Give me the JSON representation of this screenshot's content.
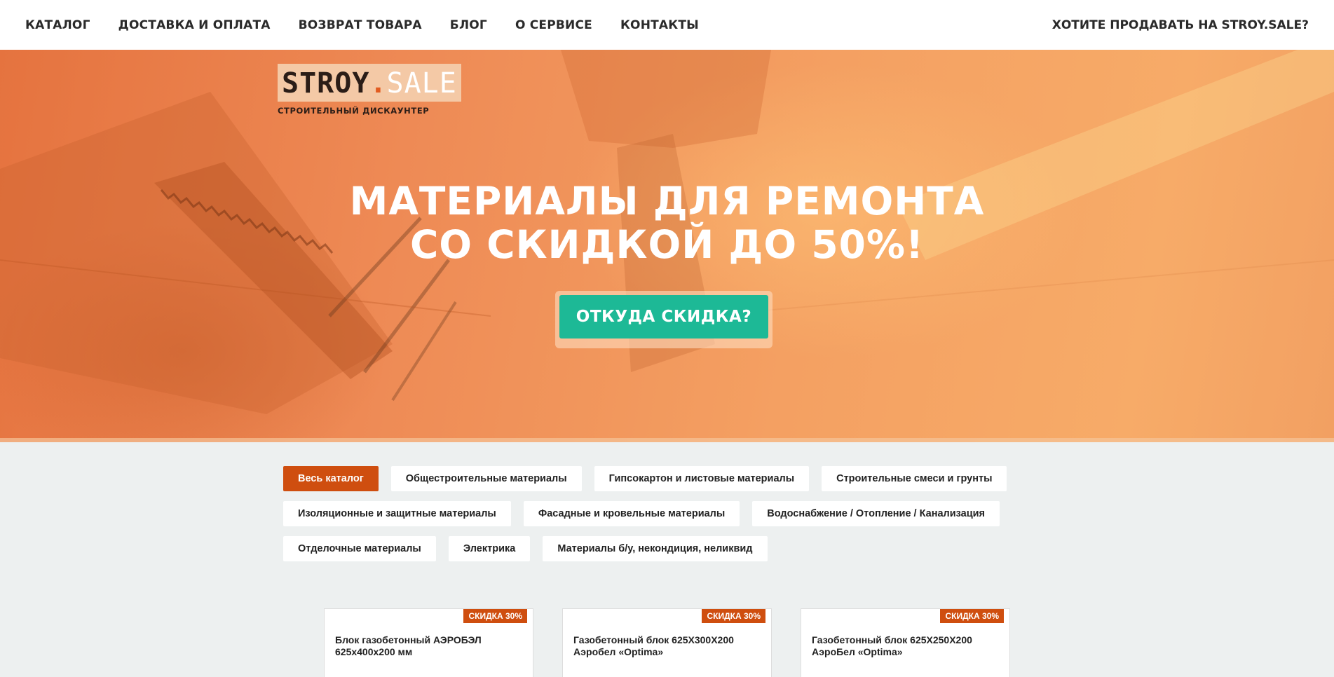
{
  "nav": {
    "items": [
      {
        "label": "КАТАЛОГ"
      },
      {
        "label": "ДОСТАВКА И ОПЛАТА"
      },
      {
        "label": "ВОЗВРАТ ТОВАРА"
      },
      {
        "label": "БЛОГ"
      },
      {
        "label": "О СЕРВИСЕ"
      },
      {
        "label": "КОНТАКТЫ"
      }
    ],
    "sell_label": "ХОТИТЕ ПРОДАВАТЬ НА STROY.SALE?"
  },
  "logo": {
    "word1": "STROY",
    "dot": ".",
    "word2": "SALE",
    "tagline": "СТРОИТЕЛЬНЫЙ ДИСКАУНТЕР"
  },
  "hero": {
    "line1": "МАТЕРИАЛЫ ДЛЯ РЕМОНТА",
    "line2": "СО СКИДКОЙ ДО 50%!",
    "cta_label": "ОТКУДА СКИДКА?"
  },
  "categories": {
    "rows": [
      [
        {
          "label": "Весь каталог",
          "active": true
        },
        {
          "label": "Общестроительные материалы"
        },
        {
          "label": "Гипсокартон и листовые материалы"
        },
        {
          "label": "Строительные смеси и грунты"
        }
      ],
      [
        {
          "label": "Изоляционные и защитные материалы"
        },
        {
          "label": "Фасадные и кровельные материалы"
        },
        {
          "label": "Водоснабжение / Отопление / Канализация"
        }
      ],
      [
        {
          "label": "Отделочные материалы"
        },
        {
          "label": "Электрика"
        },
        {
          "label": "Материалы б/у, некондиция, неликвид"
        }
      ]
    ]
  },
  "products": [
    {
      "badge": "СКИДКА 30%",
      "title": "Блок газобетонный АЭРОБЭЛ 625х400х200 мм"
    },
    {
      "badge": "СКИДКА 30%",
      "title": "Газобетонный блок 625Х300Х200 Аэробел «Optima»"
    },
    {
      "badge": "СКИДКА 30%",
      "title": "Газобетонный блок 625Х250Х200 АэроБел «Optima»"
    }
  ],
  "colors": {
    "accent": "#cf4e0f",
    "cta": "#1db996",
    "hero_orange": "#ee8a55"
  }
}
